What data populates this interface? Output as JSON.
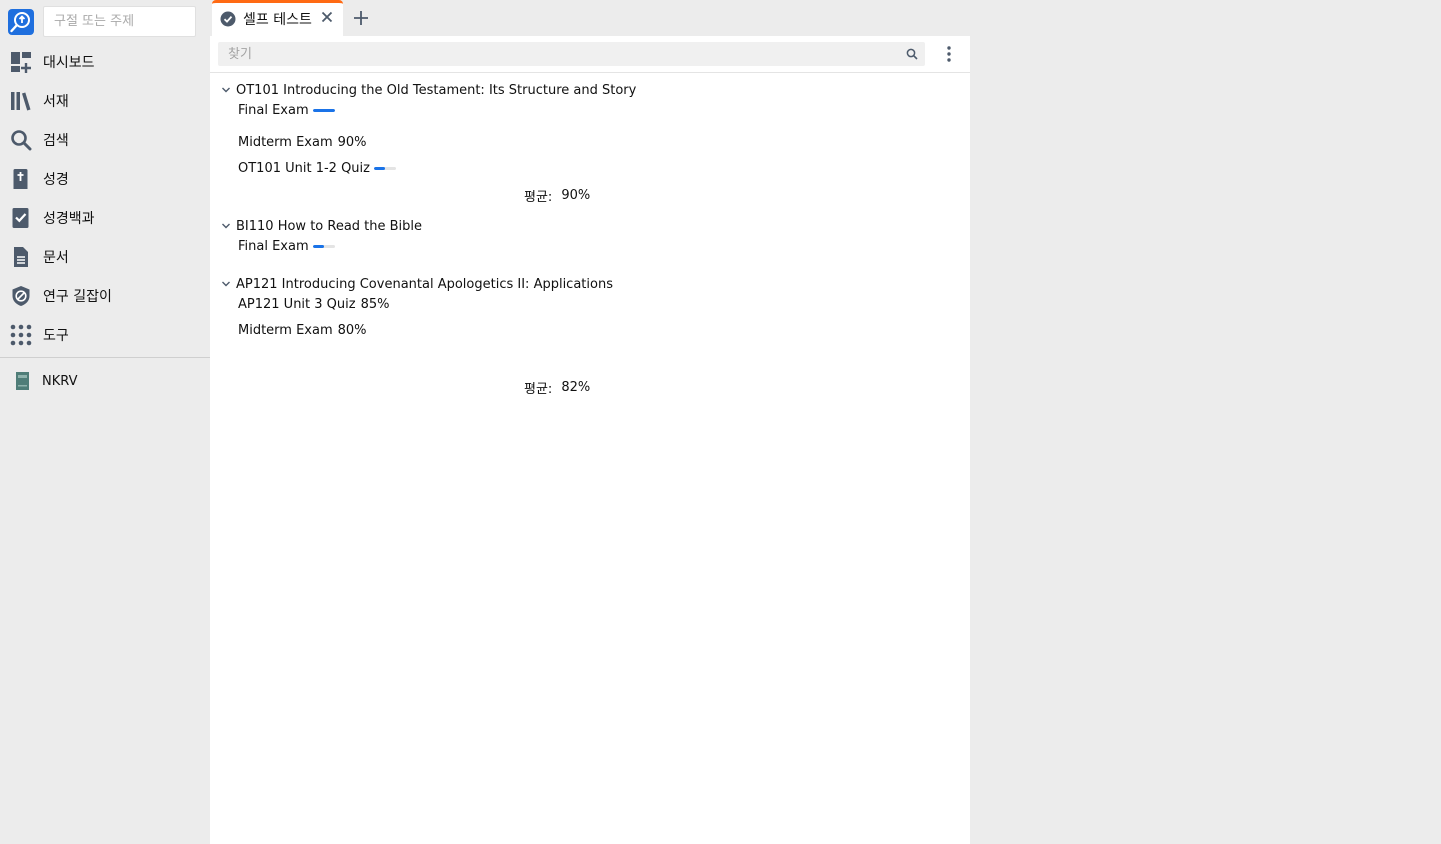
{
  "sidebar": {
    "search_placeholder": "구절 또는 주제",
    "items": [
      {
        "label": "대시보드",
        "icon": "dashboard-icon"
      },
      {
        "label": "서재",
        "icon": "library-icon"
      },
      {
        "label": "검색",
        "icon": "search-icon"
      },
      {
        "label": "성경",
        "icon": "bible-icon"
      },
      {
        "label": "성경백과",
        "icon": "factbook-icon"
      },
      {
        "label": "문서",
        "icon": "document-icon"
      },
      {
        "label": "연구 길잡이",
        "icon": "guide-icon"
      },
      {
        "label": "도구",
        "icon": "tools-grid-icon"
      }
    ],
    "recent": {
      "label": "NKRV",
      "icon": "book-cover-icon"
    }
  },
  "tab": {
    "label": "셀프 테스트",
    "icon": "check-circle-icon",
    "accent": "#ff6a13"
  },
  "panel": {
    "filter_placeholder": "찾기",
    "avg_label": "평균:",
    "courses": [
      {
        "title": "OT101 Introducing the Old Testament: Its Structure and Story",
        "tests": [
          {
            "name": "Final Exam",
            "score": "",
            "progress": 1.0
          },
          {
            "name": "Midterm Exam",
            "score": "90%",
            "progress": null
          },
          {
            "name": "OT101 Unit 1-2 Quiz",
            "score": "",
            "progress": 0.5
          }
        ],
        "average": "90%"
      },
      {
        "title": "BI110 How to Read the Bible",
        "tests": [
          {
            "name": "Final Exam",
            "score": "",
            "progress": 0.5
          }
        ],
        "average": ""
      },
      {
        "title": "AP121 Introducing Covenantal Apologetics II: Applications",
        "tests": [
          {
            "name": "AP121 Unit 3 Quiz",
            "score": "85%",
            "progress": null
          },
          {
            "name": "Midterm Exam",
            "score": "80%",
            "progress": null
          }
        ],
        "average": "82%"
      }
    ]
  },
  "colors": {
    "progress": "#1a73e8",
    "brand": "#1f6fde"
  }
}
